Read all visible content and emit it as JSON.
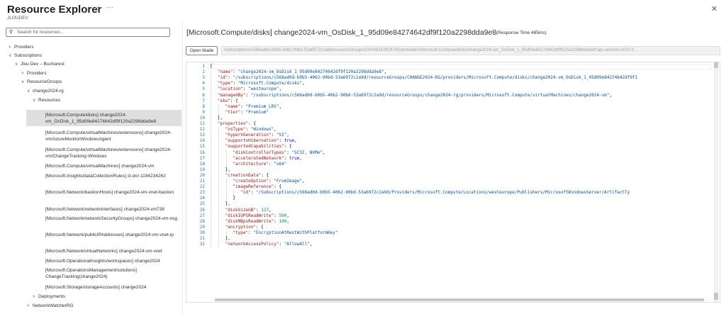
{
  "header": {
    "title": "Resource Explorer",
    "subtitle": "JLOUDEV",
    "pin_icon": "pin-icon",
    "more_icon": "more-icon",
    "close_icon": "close-icon"
  },
  "search": {
    "placeholder": "Search for resources..."
  },
  "tree": {
    "providers": "Providers",
    "subscriptions": "Subscriptions",
    "subscription": "Jlou Dev – Bucharest",
    "sub_providers": "Providers",
    "resource_groups": "ResourceGroups",
    "rg": "change2024-rg",
    "resources": "Resources",
    "items": [
      "[Microsoft.Compute/disks] change2024-vm_OsDisk_1_95d09e84274642df9f120a2298dda9e8",
      "[Microsoft.Compute/virtualMachines/extensions] change2024-vm/AzureMonitorWindowsAgent",
      "[Microsoft.Compute/virtualMachines/extensions] change2024-vm/ChangeTracking-Windows",
      "[Microsoft.Compute/virtualMachines] change2024-vm",
      "[Microsoft.Insights/dataCollectionRules] ct-dcr-1194234262",
      "[Microsoft.Network/bastionHosts] change2024-vm-vnet-bastion",
      "[Microsoft.Network/networkInterfaces] change2024-vm738",
      "[Microsoft.Network/networkSecurityGroups] change2024-vm-nsg",
      "[Microsoft.Network/publicIPAddresses] change2024-vm-vnet-ip",
      "[Microsoft.Network/virtualNetworks] change2024-vm-vnet",
      "[Microsoft.OperationalInsights/workspaces] change2024",
      "[Microsoft.OperationsManagement/solutions] ChangeTracking(change2024)",
      "[Microsoft.Storage/storageAccounts] change2024"
    ],
    "deployments": "Deployments",
    "network_watcher": "NetworkWatcherRG"
  },
  "detail": {
    "title": "[Microsoft.Compute/disks] change2024-vm_OsDisk_1_95d09e84274642df9f120a2298dda9e8",
    "response_time": "(Response Time 485ms)",
    "open_blade": "Open blade",
    "url": "/subscriptions/c568ad0d-b0b5-4062-90bd-53a6972c2a9d/resourceGroups/CHANGE2024-RG/providers/Microsoft.Compute/disks/change2024-vm_OsDisk_1_95d09e84274642df9f120a2298dda9e8?api-version=2022-0..."
  },
  "json_lines": [
    {
      "i": 0,
      "t": [
        [
          "{",
          ""
        ]
      ]
    },
    {
      "i": 1,
      "t": [
        [
          "\"name\"",
          "k"
        ],
        [
          ": ",
          ""
        ],
        [
          "\"change2024-vm_OsDisk_1_95d09e84274642df9f120a2298dda9e8\"",
          "s"
        ],
        [
          ",",
          ""
        ]
      ]
    },
    {
      "i": 1,
      "t": [
        [
          "\"id\"",
          "k"
        ],
        [
          ": ",
          ""
        ],
        [
          "\"/subscriptions/c568ad0d-b0b5-4062-90bd-53a6972c2a9d/resourceGroups/CHANGE2024-RG/providers/Microsoft.Compute/disks/change2024-vm_OsDisk_1_95d09e84274642df9f1",
          "s"
        ]
      ]
    },
    {
      "i": 1,
      "t": [
        [
          "\"type\"",
          "k"
        ],
        [
          ": ",
          ""
        ],
        [
          "\"Microsoft.Compute/disks\"",
          "s"
        ],
        [
          ",",
          ""
        ]
      ]
    },
    {
      "i": 1,
      "t": [
        [
          "\"location\"",
          "k"
        ],
        [
          ": ",
          ""
        ],
        [
          "\"westeurope\"",
          "s"
        ],
        [
          ",",
          ""
        ]
      ]
    },
    {
      "i": 1,
      "t": [
        [
          "\"managedBy\"",
          "k"
        ],
        [
          ": ",
          ""
        ],
        [
          "\"/subscriptions/c568ad0d-b0b5-4062-90bd-53a6972c2a9d/resourceGroups/change2024-rg/providers/Microsoft.Compute/virtualMachines/change2024-vm\"",
          "s"
        ],
        [
          ",",
          ""
        ]
      ]
    },
    {
      "i": 1,
      "t": [
        [
          "\"sku\"",
          "k"
        ],
        [
          ": {",
          ""
        ]
      ]
    },
    {
      "i": 2,
      "t": [
        [
          "\"name\"",
          "k"
        ],
        [
          ": ",
          ""
        ],
        [
          "\"Premium_LRS\"",
          "s"
        ],
        [
          ",",
          ""
        ]
      ]
    },
    {
      "i": 2,
      "t": [
        [
          "\"tier\"",
          "k"
        ],
        [
          ": ",
          ""
        ],
        [
          "\"Premium\"",
          "s"
        ]
      ]
    },
    {
      "i": 1,
      "t": [
        [
          "},",
          ""
        ]
      ]
    },
    {
      "i": 1,
      "t": [
        [
          "\"properties\"",
          "k"
        ],
        [
          ": {",
          ""
        ]
      ]
    },
    {
      "i": 2,
      "t": [
        [
          "\"osType\"",
          "k"
        ],
        [
          ": ",
          ""
        ],
        [
          "\"Windows\"",
          "s"
        ],
        [
          ",",
          ""
        ]
      ]
    },
    {
      "i": 2,
      "t": [
        [
          "\"hyperVGeneration\"",
          "k"
        ],
        [
          ": ",
          ""
        ],
        [
          "\"V2\"",
          "s"
        ],
        [
          ",",
          ""
        ]
      ]
    },
    {
      "i": 2,
      "t": [
        [
          "\"supportsHibernation\"",
          "k"
        ],
        [
          ": ",
          ""
        ],
        [
          "true",
          "b"
        ],
        [
          ",",
          ""
        ]
      ]
    },
    {
      "i": 2,
      "t": [
        [
          "\"supportedCapabilities\"",
          "k"
        ],
        [
          ": {",
          ""
        ]
      ]
    },
    {
      "i": 3,
      "t": [
        [
          "\"diskControllerTypes\"",
          "k"
        ],
        [
          ": ",
          ""
        ],
        [
          "\"SCSI, NVMe\"",
          "s"
        ],
        [
          ",",
          ""
        ]
      ]
    },
    {
      "i": 3,
      "t": [
        [
          "\"acceleratedNetwork\"",
          "k"
        ],
        [
          ": ",
          ""
        ],
        [
          "true",
          "b"
        ],
        [
          ",",
          ""
        ]
      ]
    },
    {
      "i": 3,
      "t": [
        [
          "\"architecture\"",
          "k"
        ],
        [
          ": ",
          ""
        ],
        [
          "\"x64\"",
          "s"
        ]
      ]
    },
    {
      "i": 2,
      "t": [
        [
          "},",
          ""
        ]
      ]
    },
    {
      "i": 2,
      "t": [
        [
          "\"creationData\"",
          "k"
        ],
        [
          ": {",
          ""
        ]
      ]
    },
    {
      "i": 3,
      "t": [
        [
          "\"createOption\"",
          "k"
        ],
        [
          ": ",
          ""
        ],
        [
          "\"FromImage\"",
          "s"
        ],
        [
          ",",
          ""
        ]
      ]
    },
    {
      "i": 3,
      "t": [
        [
          "\"imageReference\"",
          "k"
        ],
        [
          ": {",
          ""
        ]
      ]
    },
    {
      "i": 4,
      "t": [
        [
          "\"id\"",
          "k"
        ],
        [
          ": ",
          ""
        ],
        [
          "\"/Subscriptions/c568ad0d-b0b5-4062-90bd-53a6972c2a9d/Providers/Microsoft.Compute/Locations/westeurope/Publishers/MicrosoftWindowsServer/ArtifactTy",
          "s"
        ]
      ]
    },
    {
      "i": 3,
      "t": [
        [
          "}",
          ""
        ]
      ]
    },
    {
      "i": 2,
      "t": [
        [
          "},",
          ""
        ]
      ]
    },
    {
      "i": 2,
      "t": [
        [
          "\"diskSizeGB\"",
          "k"
        ],
        [
          ": ",
          ""
        ],
        [
          "127",
          "n"
        ],
        [
          ",",
          ""
        ]
      ]
    },
    {
      "i": 2,
      "t": [
        [
          "\"diskIOPSReadWrite\"",
          "k"
        ],
        [
          ": ",
          ""
        ],
        [
          "500",
          "n"
        ],
        [
          ",",
          ""
        ]
      ]
    },
    {
      "i": 2,
      "t": [
        [
          "\"diskMBpsReadWrite\"",
          "k"
        ],
        [
          ": ",
          ""
        ],
        [
          "100",
          "n"
        ],
        [
          ",",
          ""
        ]
      ]
    },
    {
      "i": 2,
      "t": [
        [
          "\"encryption\"",
          "k"
        ],
        [
          ": {",
          ""
        ]
      ]
    },
    {
      "i": 3,
      "t": [
        [
          "\"type\"",
          "k"
        ],
        [
          ": ",
          ""
        ],
        [
          "\"EncryptionAtRestWithPlatformKey\"",
          "s"
        ]
      ]
    },
    {
      "i": 2,
      "t": [
        [
          "},",
          ""
        ]
      ]
    },
    {
      "i": 2,
      "t": [
        [
          "\"networkAccessPolicy\"",
          "k"
        ],
        [
          ": ",
          ""
        ],
        [
          "\"AllowAll\"",
          "s"
        ],
        [
          ",",
          ""
        ]
      ]
    }
  ]
}
